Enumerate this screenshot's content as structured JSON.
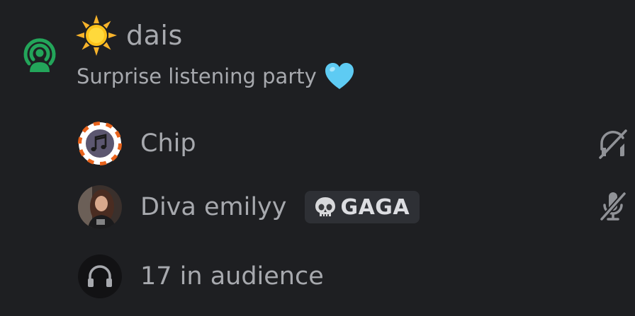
{
  "channel": {
    "icon": "stage-channel-icon",
    "emoji": "sun-emoji",
    "name": "dais",
    "topic": "Surprise listening party",
    "topic_emoji": "light-blue-heart-emoji"
  },
  "speakers": [
    {
      "name": "Chip",
      "avatar": "music-note-chip-avatar",
      "status_icon": "deafened-headphones-slash-icon"
    },
    {
      "name": "Diva emilyy",
      "avatar": "user-photo-avatar",
      "badge": {
        "emoji": "skull-emoji",
        "label": "GAGA"
      },
      "status_icon": "muted-microphone-slash-icon"
    }
  ],
  "audience": {
    "label": "17 in audience",
    "icon": "headphones-icon"
  },
  "colors": {
    "background": "#1e1f22",
    "text": "#a7a9ae",
    "stage_green": "#23a55a",
    "badge_bg": "#2e3035",
    "heart_blue": "#5ecbf3",
    "chip_orange": "#e8631c"
  }
}
